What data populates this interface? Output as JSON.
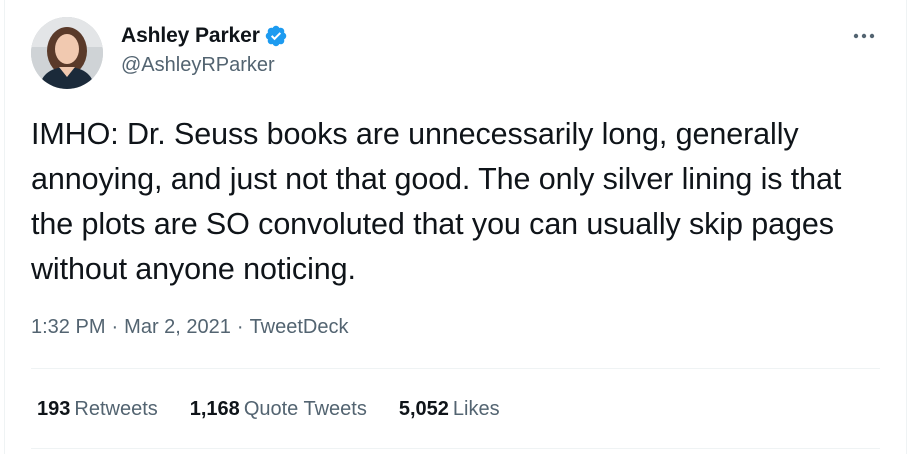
{
  "author": {
    "name": "Ashley Parker",
    "handle": "@AshleyRParker",
    "verified": true,
    "avatar_icon": "profile-photo"
  },
  "tweet": {
    "text": "IMHO: Dr. Seuss books are unnecessarily long, generally annoying, and just not that good. The only silver lining is that the plots are SO convoluted that you can usually skip pages without anyone noticing.",
    "time": "1:32 PM",
    "date": "Mar 2, 2021",
    "source": "TweetDeck",
    "separator": "·"
  },
  "stats": {
    "retweets": {
      "count": "193",
      "label": "Retweets"
    },
    "quotes": {
      "count": "1,168",
      "label": "Quote Tweets"
    },
    "likes": {
      "count": "5,052",
      "label": "Likes"
    }
  },
  "icons": {
    "more": "more-horizontal-icon",
    "verified": "verified-badge-icon"
  },
  "colors": {
    "primary_text": "#0f1419",
    "secondary_text": "#536471",
    "verified_blue": "#1d9bf0",
    "divider": "#eff3f4"
  }
}
